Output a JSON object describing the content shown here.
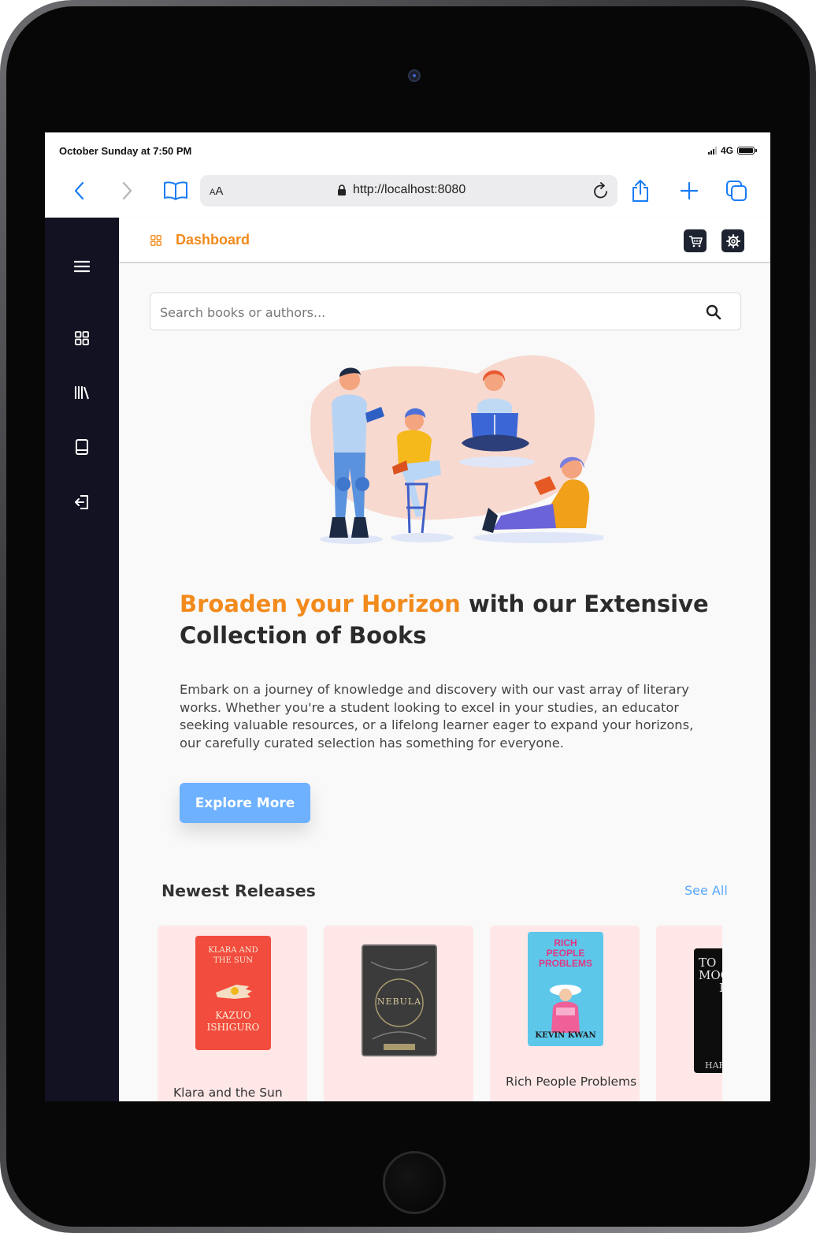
{
  "status_bar": {
    "time": "October Sunday at 7:50 PM",
    "network": "4G"
  },
  "browser": {
    "aa_small": "A",
    "aa_big": "A",
    "url": "http://localhost:8080"
  },
  "app": {
    "page_title": "Dashboard",
    "search_placeholder": "Search books or authors...",
    "headline_accent": "Broaden your Horizon",
    "headline_rest": " with our Extensive Collection of Books",
    "description": "Embark on a journey of knowledge and discovery with our vast array of literary works. Whether you're a student looking to excel in your studies, an educator seeking valuable resources, or a lifelong learner eager to expand your horizons, our carefully curated selection has something for everyone.",
    "explore_label": "Explore More",
    "section_title": "Newest Releases",
    "see_all_label": "See All",
    "accent_color": "#f28a1c",
    "button_color": "#6db1ff"
  },
  "books": [
    {
      "title": "Klara and the Sun",
      "cover_lines": [
        "KLARA AND",
        "THE SUN",
        "KAZUO",
        "ISHIGURO"
      ],
      "cover_color": "#f14c3d"
    },
    {
      "title": "",
      "cover_text": "NEBULA",
      "cover_color": "#3b3b3b"
    },
    {
      "title": "Rich People Problems",
      "cover_lines": [
        "RICH",
        "PEOPLE",
        "PROBLEMS",
        "KEVIN KWAN"
      ],
      "cover_color": "#5dc7ea"
    },
    {
      "title": "",
      "cover_lines": [
        "TO",
        "MOC",
        "B",
        "HAR"
      ],
      "cover_color": "#0d0d0d"
    }
  ]
}
